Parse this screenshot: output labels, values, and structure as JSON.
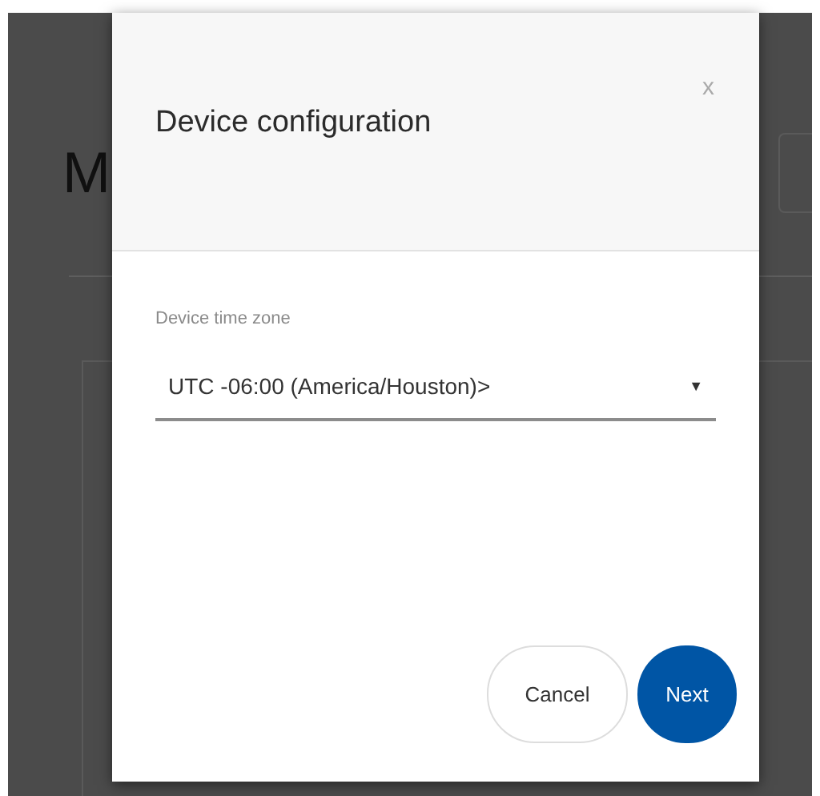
{
  "background": {
    "heading": "M"
  },
  "dialog": {
    "title": "Device configuration",
    "close": "x",
    "field": {
      "label": "Device time zone",
      "value": "UTC -06:00 (America/Houston)>",
      "caret": "▼"
    },
    "buttons": [
      {
        "label": "Cancel",
        "kind": "secondary"
      },
      {
        "label": "Next",
        "kind": "primary"
      }
    ]
  }
}
